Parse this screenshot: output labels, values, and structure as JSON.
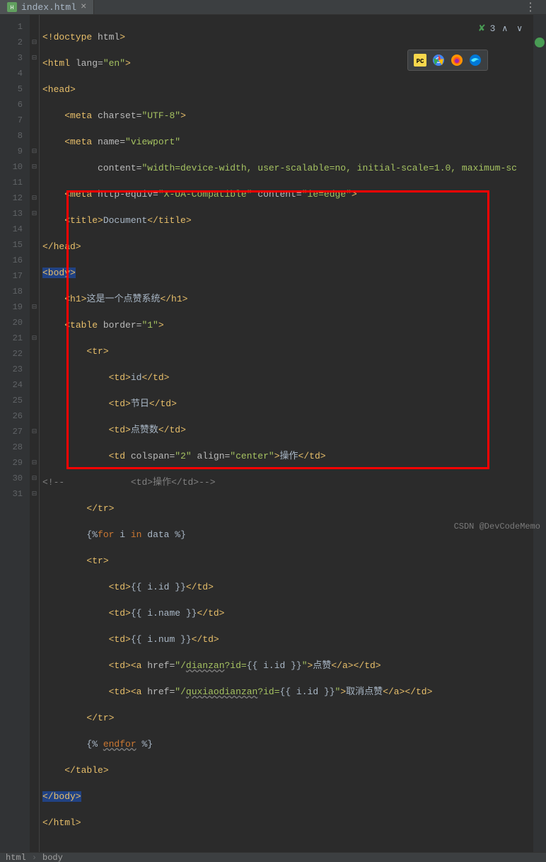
{
  "tab": {
    "filename": "index.html"
  },
  "inspection": {
    "count": "3"
  },
  "lines": [
    "1",
    "2",
    "3",
    "4",
    "5",
    "6",
    "7",
    "8",
    "9",
    "10",
    "11",
    "12",
    "13",
    "14",
    "15",
    "16",
    "17",
    "18",
    "19",
    "20",
    "21",
    "22",
    "23",
    "24",
    "25",
    "26",
    "27",
    "28",
    "29",
    "30",
    "31"
  ],
  "code": {
    "l1_open": "<!doctype ",
    "l1_attr": "html",
    "l1_close": ">",
    "l2_open": "<html ",
    "l2_attr": "lang=",
    "l2_val": "\"en\"",
    "l2_close": ">",
    "l3": "<head>",
    "l4_open": "<meta ",
    "l4_attr": "charset=",
    "l4_val": "\"UTF-8\"",
    "l4_close": ">",
    "l5_open": "<meta ",
    "l5_attr": "name=",
    "l5_val": "\"viewport\"",
    "l6_attr": "content=",
    "l6_val": "\"width=device-width, user-scalable=no, initial-scale=1.0, maximum-sc",
    "l7_open": "<meta ",
    "l7_a1": "http-equiv=",
    "l7_v1": "\"X-UA-Compatible\" ",
    "l7_a2": "content=",
    "l7_v2": "\"ie=edge\"",
    "l7_close": ">",
    "l8_open": "<title>",
    "l8_txt": "Document",
    "l8_close": "</title>",
    "l9": "</head>",
    "l10": "<body>",
    "l11_open": "<h1>",
    "l11_txt": "这是一个点赞系统",
    "l11_close": "</h1>",
    "l12_open": "<table ",
    "l12_attr": "border=",
    "l12_val": "\"1\"",
    "l12_close": ">",
    "l13": "<tr>",
    "l14_open": "<td>",
    "l14_txt": "id",
    "l14_close": "</td>",
    "l15_open": "<td>",
    "l15_txt": "节日",
    "l15_close": "</td>",
    "l16_open": "<td>",
    "l16_txt": "点赞数",
    "l16_close": "</td>",
    "l17_open": "<td ",
    "l17_a1": "colspan=",
    "l17_v1": "\"2\" ",
    "l17_a2": "align=",
    "l17_v2": "\"center\"",
    "l17_close": ">",
    "l17_txt": "操作",
    "l17_end": "</td>",
    "l18_pre": "<!--",
    "l18_open": "<td>",
    "l18_txt": "操作",
    "l18_close": "</td>",
    "l18_suf": "-->",
    "l19": "</tr>",
    "l20_open": "{%",
    "l20_kw": "for ",
    "l20_txt": "i ",
    "l20_in": "in ",
    "l20_data": "data ",
    "l20_close": "%}",
    "l21": "<tr>",
    "l22_open": "<td>",
    "l22_expr": "{{ i.id }}",
    "l22_close": "</td>",
    "l23_open": "<td>",
    "l23_expr": "{{ i.name }}",
    "l23_close": "</td>",
    "l24_open": "<td>",
    "l24_expr": "{{ i.num }}",
    "l24_close": "</td>",
    "l25_td": "<td>",
    "l25_a": "<a ",
    "l25_attr": "href=",
    "l25_q": "\"",
    "l25_path": "/",
    "l25_route": "dianzan",
    "l25_qs": "?id=",
    "l25_expr": "{{ i.id }}",
    "l25_q2": "\"",
    "l25_close": ">",
    "l25_txt": "点赞",
    "l25_ea": "</a>",
    "l25_etd": "</td>",
    "l26_td": "<td>",
    "l26_a": "<a ",
    "l26_attr": "href=",
    "l26_q": "\"",
    "l26_path": "/",
    "l26_route": "quxiaodianzan",
    "l26_qs": "?id=",
    "l26_expr": "{{ i.id }}",
    "l26_q2": "\"",
    "l26_close": ">",
    "l26_txt": "取消点赞",
    "l26_ea": "</a>",
    "l26_etd": "</td>",
    "l27": "</tr>",
    "l28_open": "{% ",
    "l28_kw": "endfor",
    "l28_close": " %}",
    "l29": "</table>",
    "l30": "</body>",
    "l31": "</html>"
  },
  "breadcrumb": {
    "p1": "html",
    "p2": "body"
  },
  "watermark": "CSDN @DevCodeMemo"
}
